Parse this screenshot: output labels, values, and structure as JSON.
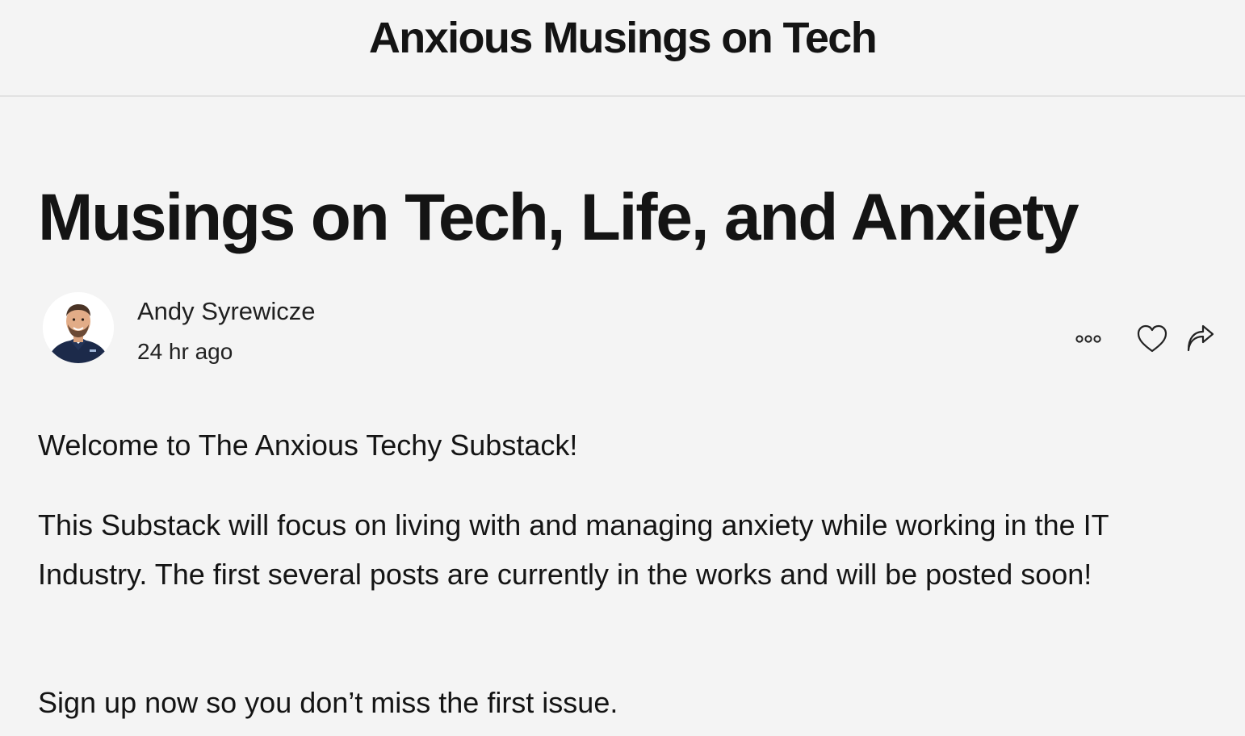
{
  "header": {
    "site_title": "Anxious Musings on Tech"
  },
  "post": {
    "title": "Musings on Tech, Life, and Anxiety",
    "author": "Andy Syrewicze",
    "date": "24 hr ago",
    "paragraphs": [
      "Welcome to The Anxious Techy Substack!",
      "This Substack will focus on living with and managing anxiety while working in the IT Industry. The first several posts are currently in the works and will be posted soon!",
      "Sign up now so you don’t miss the first issue."
    ]
  },
  "actions": {
    "icons": [
      "more-icon",
      "heart-icon",
      "share-icon"
    ]
  }
}
